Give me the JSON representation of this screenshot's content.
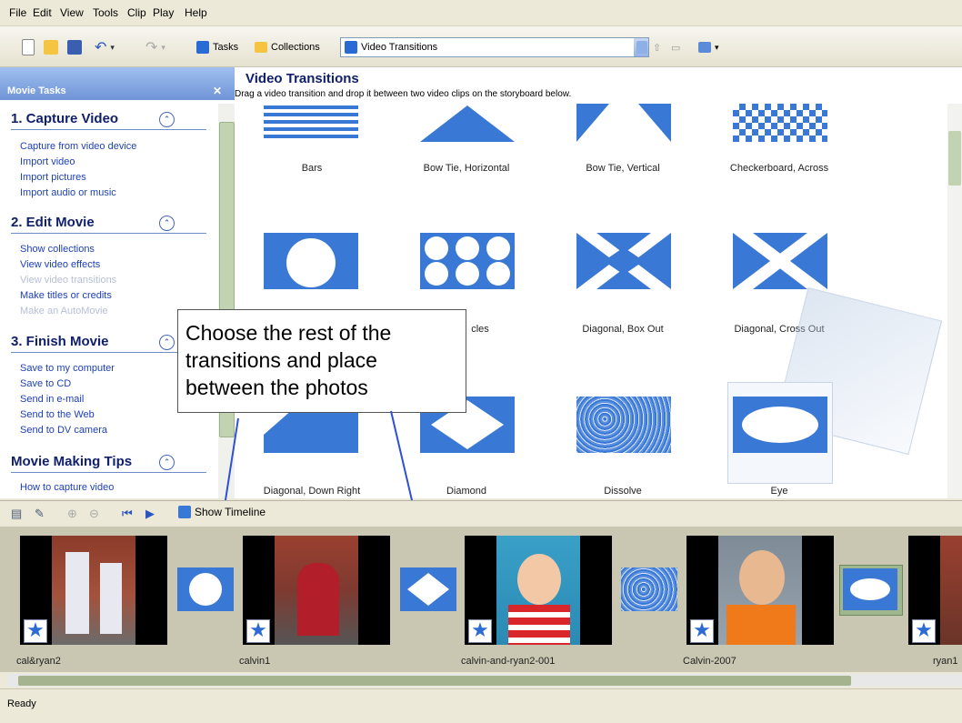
{
  "menu": [
    "File",
    "Edit",
    "View",
    "Tools",
    "Clip",
    "Play",
    "Help"
  ],
  "toolbar": {
    "tasks_label": "Tasks",
    "collections_label": "Collections",
    "combo_value": "Video Transitions"
  },
  "taskpane": {
    "header": "Movie Tasks",
    "sections": [
      {
        "title": "1. Capture Video",
        "links": [
          {
            "label": "Capture from video device"
          },
          {
            "label": "Import video"
          },
          {
            "label": "Import pictures"
          },
          {
            "label": "Import audio or music"
          }
        ]
      },
      {
        "title": "2. Edit Movie",
        "links": [
          {
            "label": "Show collections"
          },
          {
            "label": "View video effects"
          },
          {
            "label": "View video transitions"
          },
          {
            "label": "Make titles or credits"
          },
          {
            "label": "Make an AutoMovie"
          }
        ]
      },
      {
        "title": "3. Finish Movie",
        "links": [
          {
            "label": "Save to my computer"
          },
          {
            "label": "Save to CD"
          },
          {
            "label": "Send in e-mail"
          },
          {
            "label": "Send to the Web"
          },
          {
            "label": "Send to DV camera"
          }
        ]
      },
      {
        "title": "Movie Making Tips",
        "links": [
          {
            "label": "How to capture video"
          }
        ]
      }
    ]
  },
  "content": {
    "title": "Video Transitions",
    "subtitle": "Drag a video transition and drop it between two video clips on the storyboard below.",
    "transitions": [
      {
        "label": "Bars"
      },
      {
        "label": "Bow Tie, Horizontal"
      },
      {
        "label": "Bow Tie, Vertical"
      },
      {
        "label": "Checkerboard, Across"
      },
      {
        "label": ""
      },
      {
        "label": "cles"
      },
      {
        "label": "Diagonal, Box Out"
      },
      {
        "label": "Diagonal, Cross Out"
      },
      {
        "label": "Diagonal, Down Right"
      },
      {
        "label": "Diamond"
      },
      {
        "label": "Dissolve"
      },
      {
        "label": "Eye"
      }
    ]
  },
  "callout": "Choose the rest of the transitions and place between the photos",
  "storyboard_toolbar": {
    "show_timeline": "Show Timeline"
  },
  "clips": [
    {
      "label": "cal&ryan2"
    },
    {
      "label": "calvin1"
    },
    {
      "label": "calvin-and-ryan2-001"
    },
    {
      "label": "Calvin-2007"
    },
    {
      "label": "ryan1"
    }
  ],
  "status": "Ready"
}
